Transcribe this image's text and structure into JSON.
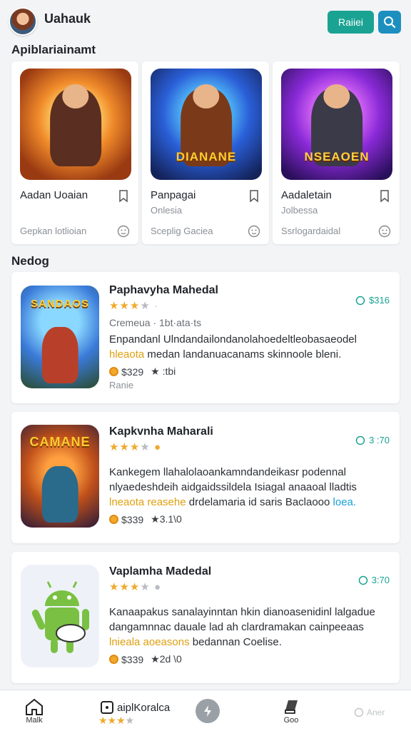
{
  "header": {
    "username": "Uahauk",
    "primary_button": "Raiiei"
  },
  "section1": {
    "title": "Apiblariainamt"
  },
  "featured": [
    {
      "title": "Aadan Uoaian",
      "subtitle": "",
      "meta": "Gepkan lotlioian",
      "art_text": ""
    },
    {
      "title": "Panpagai",
      "subtitle": "Onlesia",
      "meta": "Sceplig Gaciea",
      "art_text": "DIANANE"
    },
    {
      "title": "Aadaletain",
      "subtitle": "Jolbessa",
      "meta": "Ssrlogardaidal",
      "art_text": "NSEAOEN"
    }
  ],
  "section2": {
    "title": "Nedog"
  },
  "list": [
    {
      "title": "Paphavyha Mahedal",
      "rating": "3",
      "badge": "$316",
      "subtitle": "Cremeua · 1bt·ata·ts",
      "desc_line1": "Enpandanl Ulndandailondanolahoedeltleobasaeodel",
      "desc_hl": "hleaota",
      "desc_line2_rest": " medan landanuacanams skinnoole bleni.",
      "price": "$329",
      "extra": "★ :tbi",
      "tag": "Ranie",
      "art_text": "SANDAOS"
    },
    {
      "title": "Kapkvnha Maharali",
      "rating": "3",
      "badge": "3 :70",
      "subtitle": "",
      "desc_line1": "Kankegem llahalolaoankamndandeikasr podennal",
      "desc_line2": "nlyaedeshdeih aidgaidssildela Isiagal anaaoal lladtis",
      "desc_hl": "lneaota reasehe",
      "desc_line3_rest": " drdelamaria id saris Baclaooo ",
      "desc_hl2": "loea.",
      "price": "$339",
      "extra": "★3.1\\0",
      "art_text": "CAMANE"
    },
    {
      "title": "Vaplamha Madedal",
      "rating": "3",
      "badge": "3:70",
      "subtitle": "",
      "desc_line1": "Kanaapakus sanalayinntan hkin dianoasenidinl lalgadue",
      "desc_line2": "dangamnnac dauale lad ah clardramakan cainpeeaas",
      "desc_hl": "lnieala aoeasons",
      "desc_line3_rest": " bedannan Coelise.",
      "price": "$339",
      "extra": "★2d \\0"
    }
  ],
  "bottom_nav": {
    "home": "Malk",
    "center_label": "aiplKoralca",
    "right_label": "Goo",
    "ghost": "Aner"
  },
  "colors": {
    "teal": "#1aa393",
    "blue": "#1d8fbf",
    "star": "#f0a92b"
  }
}
